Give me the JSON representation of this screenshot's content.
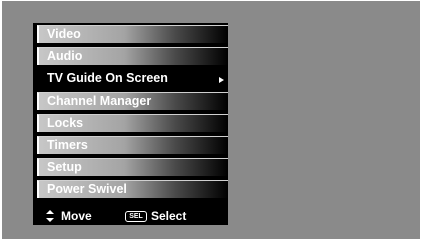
{
  "menu": {
    "items": [
      {
        "label": "Video"
      },
      {
        "label": "Audio"
      },
      {
        "label": "TV Guide On Screen"
      },
      {
        "label": "Channel Manager"
      },
      {
        "label": "Locks"
      },
      {
        "label": "Timers"
      },
      {
        "label": "Setup"
      },
      {
        "label": "Power Swivel"
      }
    ],
    "selected_index": 2
  },
  "footer": {
    "move_label": "Move",
    "sel_icon_label": "SEL",
    "select_label": "Select"
  },
  "colors": {
    "screen_bg": "#8a8a8a",
    "menu_bg": "#000000",
    "item_gradient_start": "#c7c7c7",
    "text": "#ffffff"
  },
  "icons": [
    "up-down-arrow-icon",
    "sel-button-icon",
    "submenu-arrow-icon"
  ]
}
